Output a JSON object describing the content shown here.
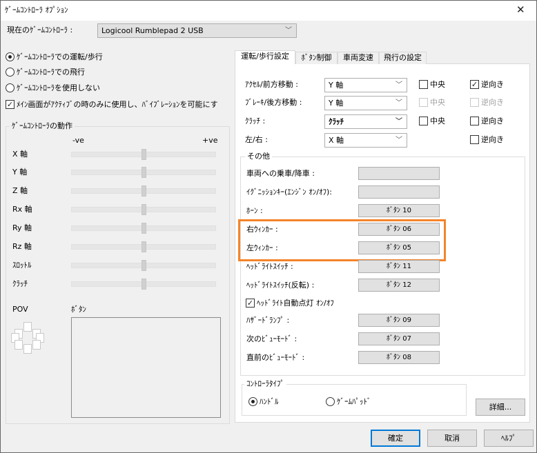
{
  "window": {
    "title": "ｹﾞｰﾑｺﾝﾄﾛｰﾗ ｵﾌﾟｼｮﾝ",
    "close_icon": "close-icon"
  },
  "controller": {
    "label": "現在のｹﾞｰﾑｺﾝﾄﾛｰﾗ :",
    "value": "Logicool Rumblepad 2 USB"
  },
  "modes": [
    {
      "label": "ｹﾞｰﾑｺﾝﾄﾛｰﾗでの運転/歩行",
      "selected": true
    },
    {
      "label": "ｹﾞｰﾑｺﾝﾄﾛｰﾗでの飛行",
      "selected": false
    },
    {
      "label": "ｹﾞｰﾑｺﾝﾄﾛｰﾗを使用しない",
      "selected": false
    }
  ],
  "vibration": {
    "label": "ﾒｲﾝ画面がｱｸﾃｨﾌﾞの時のみに使用し、ﾊﾞｲﾌﾞﾚｰｼｮﾝを可能にす",
    "checked": true
  },
  "actions": {
    "title": "ｹﾞｰﾑｺﾝﾄﾛｰﾗの動作",
    "neg": "-ve",
    "pos": "+ve",
    "axes": [
      {
        "label": "X 軸",
        "value": 0
      },
      {
        "label": "Y 軸",
        "value": 0
      },
      {
        "label": "Z 軸",
        "value": 0
      },
      {
        "label": "Rx 軸",
        "value": 0
      },
      {
        "label": "Ry 軸",
        "value": 0
      },
      {
        "label": "Rz 軸",
        "value": 0
      },
      {
        "label": "ｽﾛｯﾄﾙ",
        "value": 0
      },
      {
        "label": "ｸﾗｯﾁ",
        "value": 0
      }
    ],
    "pov_label": "POV",
    "buttons_label": "ﾎﾞﾀﾝ"
  },
  "tabs": [
    {
      "label": "運転/歩行設定",
      "selected": true
    },
    {
      "label": "ﾎﾞﾀﾝ制御",
      "selected": false
    },
    {
      "label": "車両変速",
      "selected": false
    },
    {
      "label": "飛行の設定",
      "selected": false
    }
  ],
  "axis_rows": [
    {
      "label": "ｱｸｾﾙ/前方移動 :",
      "value": "Y 軸",
      "center": {
        "label": "中央",
        "checked": false,
        "enabled": true
      },
      "reverse": {
        "label": "逆向き",
        "checked": true,
        "enabled": true
      }
    },
    {
      "label": "ﾌﾞﾚｰｷ/後方移動 :",
      "value": "Y 軸",
      "center": {
        "label": "中央",
        "checked": false,
        "enabled": false
      },
      "reverse": {
        "label": "逆向き",
        "checked": false,
        "enabled": false
      }
    },
    {
      "label": "ｸﾗｯﾁ :",
      "value": "ｸﾗｯﾁ",
      "center": {
        "label": "中央",
        "checked": false,
        "enabled": true
      },
      "reverse": {
        "label": "逆向き",
        "checked": false,
        "enabled": true
      }
    },
    {
      "label": "左/右 :",
      "value": "X 軸",
      "reverse": {
        "label": "逆向き",
        "checked": false,
        "enabled": true
      }
    }
  ],
  "other": {
    "title": "その他",
    "rows": [
      {
        "label": "車両への乗車/降車 :",
        "value": ""
      },
      {
        "label": "ｲｸﾞﾆｯｼｮﾝｷｰ(ｴﾝｼﾞﾝ ｵﾝ/ｵﾌ):",
        "value": ""
      },
      {
        "label": "ﾎｰﾝ :",
        "value": "ﾎﾞﾀﾝ 10"
      },
      {
        "label": "右ｳｨﾝｶｰ :",
        "value": "ﾎﾞﾀﾝ 06"
      },
      {
        "label": "左ｳｨﾝｶｰ :",
        "value": "ﾎﾞﾀﾝ 05"
      },
      {
        "label": "ﾍｯﾄﾞﾗｲﾄｽｲｯﾁ :",
        "value": "ﾎﾞﾀﾝ 11"
      },
      {
        "label": "ﾍｯﾄﾞﾗｲﾄｽｲｯﾁ(反転) :",
        "value": "ﾎﾞﾀﾝ 12"
      }
    ],
    "auto_headlight": {
      "label": "ﾍｯﾄﾞﾗｲﾄ自動点灯 ｵﾝ/ｵﾌ",
      "checked": true
    },
    "rows2": [
      {
        "label": "ﾊｻﾞｰﾄﾞﾗﾝﾌﾟ :",
        "value": "ﾎﾞﾀﾝ 09"
      },
      {
        "label": "次のﾋﾞｭｰﾓｰﾄﾞ :",
        "value": "ﾎﾞﾀﾝ 07"
      },
      {
        "label": "直前のﾋﾞｭｰﾓｰﾄﾞ :",
        "value": "ﾎﾞﾀﾝ 08"
      }
    ]
  },
  "controller_type": {
    "title": "ｺﾝﾄﾛｰﾗﾀｲﾌﾟ",
    "options": [
      {
        "label": "ﾊﾝﾄﾞﾙ",
        "selected": true
      },
      {
        "label": "ｹﾞｰﾑﾊﾟｯﾄﾞ",
        "selected": false
      }
    ]
  },
  "details_button": "詳細...",
  "footer": {
    "ok": "確定",
    "cancel": "取消",
    "help": "ﾍﾙﾌﾟ"
  },
  "highlight_color": "#f5842a"
}
